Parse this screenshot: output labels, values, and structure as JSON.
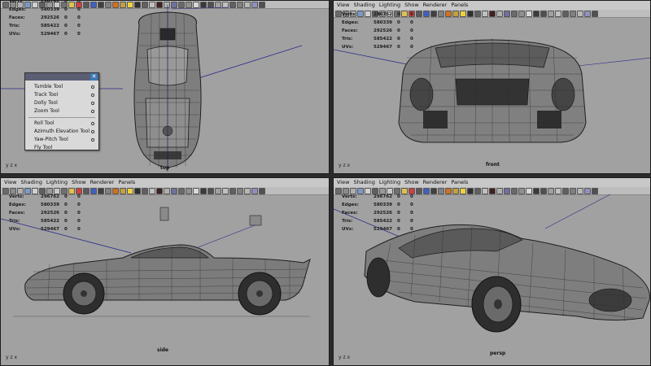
{
  "menu": [
    "View",
    "Shading",
    "Lighting",
    "Show",
    "Renderer",
    "Panels"
  ],
  "hud": {
    "rows": [
      {
        "label": "Verts:",
        "value": "296762",
        "a": "0",
        "b": "0"
      },
      {
        "label": "Edges:",
        "value": "580339",
        "a": "0",
        "b": "0"
      },
      {
        "label": "Faces:",
        "value": "292526",
        "a": "0",
        "b": "0"
      },
      {
        "label": "Tris:",
        "value": "585422",
        "a": "0",
        "b": "0"
      },
      {
        "label": "UVs:",
        "value": "529467",
        "a": "0",
        "b": "0"
      }
    ]
  },
  "cameras": {
    "top": "top",
    "front": "front",
    "side": "side",
    "persp": "persp"
  },
  "axis_label": "y z x",
  "popup": {
    "group1": [
      "Tumble Tool",
      "Track Tool",
      "Dolly Tool",
      "Zoom Tool"
    ],
    "group2": [
      "Roll Tool",
      "Azimuth Elevation Tool",
      "Yaw-Pitch Tool",
      "Fly Tool"
    ],
    "close": "✕"
  },
  "toolbar_icons": [
    "camera-select-icon",
    "camera-attr-icon",
    "bookmark-icon",
    "image-plane-icon",
    "grid-icon",
    "film-gate-icon",
    "resolution-gate-icon",
    "gate-mask-icon",
    "field-chart-icon",
    "safe-action-icon",
    "safe-title-icon",
    "wireframe-icon",
    "smooth-shade-icon",
    "default-light-icon",
    "textured-icon",
    "shadows-icon",
    "xray-icon",
    "isolate-icon",
    "xray-joints-icon",
    "backface-icon",
    "ao-icon",
    "aa-icon",
    "dof-icon",
    "motion-blur-icon",
    "hypershade-icon",
    "render-icon",
    "ipr-icon",
    "light-icon",
    "material-icon",
    "color-icon",
    "frame-all-icon",
    "frame-sel-icon",
    "wire-on-shaded-icon",
    "shaded-icon",
    "pan-icon",
    "grid-toggle-icon"
  ],
  "toolbar_colors": [
    "#6b6b6b",
    "#8a8a8a",
    "#b0b0b0",
    "#7a9ac8",
    "#d0d0d0",
    "#5f5f5f",
    "#9a9a9a",
    "#c8c8c8",
    "#707070",
    "#e0c050",
    "#d04040",
    "#5a5a5a",
    "#4060c0",
    "#404040",
    "#808080",
    "#d07020",
    "#c0a040",
    "#f0d040",
    "#303030",
    "#606060",
    "#c0c0c0",
    "#402020",
    "#b0b0b0",
    "#7070a0",
    "#6a6a6a",
    "#909090",
    "#d8d8d8",
    "#3a3a3a",
    "#505050",
    "#a0a0a0",
    "#c0c0c0",
    "#606060",
    "#808080",
    "#b8b8b8",
    "#9090c0",
    "#505050"
  ]
}
